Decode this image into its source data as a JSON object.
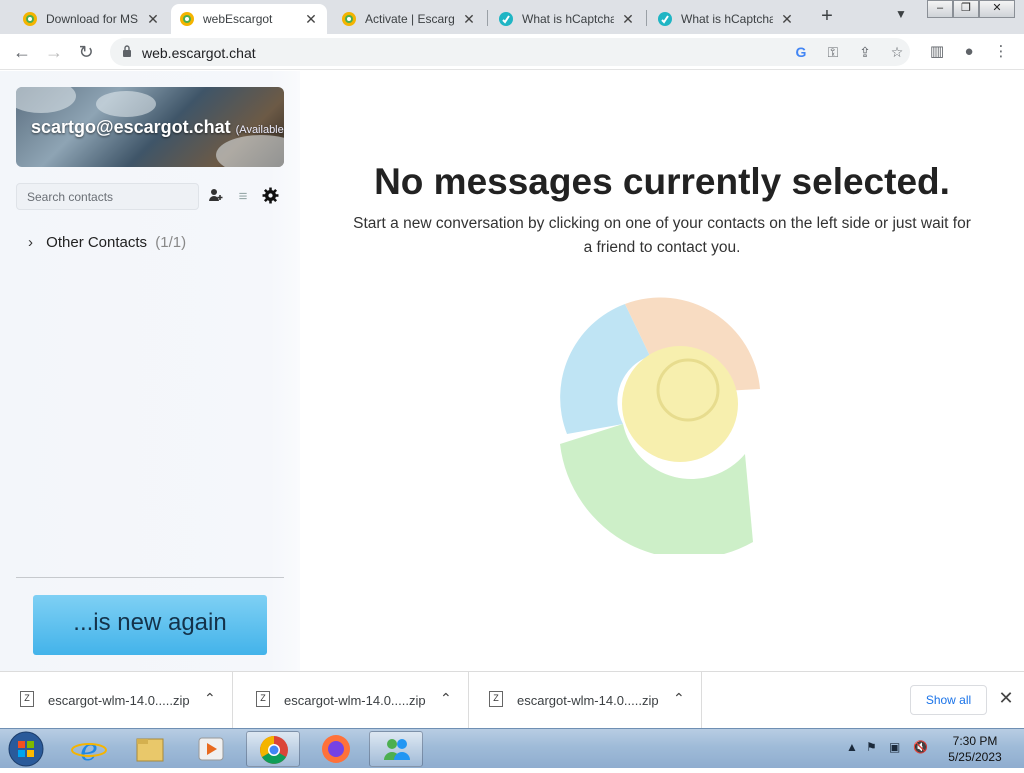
{
  "browser": {
    "tabs": [
      {
        "title": "Download for MSN",
        "favicon": "escargot-icon",
        "active": false
      },
      {
        "title": "webEscargot",
        "favicon": "escargot-icon",
        "active": true
      },
      {
        "title": "Activate | Escargot",
        "favicon": "escargot-icon",
        "active": false
      },
      {
        "title": "What is hCaptcha",
        "favicon": "hcaptcha-icon",
        "active": false
      },
      {
        "title": "What is hCaptcha",
        "favicon": "hcaptcha-icon",
        "active": false
      }
    ],
    "new_tab_label": "+",
    "url": "web.escargot.chat"
  },
  "sidebar": {
    "profile": {
      "email": "scartgo@escargot.chat",
      "status": "(Available)"
    },
    "search_placeholder": "Search contacts",
    "group": {
      "name": "Other Contacts",
      "count": "(1/1)"
    },
    "banner_text": "...is new again"
  },
  "main": {
    "title": "No messages currently selected.",
    "subtitle": "Start a new conversation by clicking on one of your contacts on the left side or just wait for a friend to contact you."
  },
  "downloads": {
    "items": [
      {
        "name": "escargot-wlm-14.0.....zip"
      },
      {
        "name": "escargot-wlm-14.0.....zip"
      },
      {
        "name": "escargot-wlm-14.0.....zip"
      }
    ],
    "show_all_label": "Show all"
  },
  "taskbar": {
    "time": "7:30 PM",
    "date": "5/25/2023"
  },
  "colors": {
    "accent": "#1a73e8",
    "banner": "#43b3ea",
    "logo_blue": "#bfe4f4",
    "logo_orange": "#f8dcc2",
    "logo_yellow": "#f7efae",
    "logo_green": "#cdefc8"
  }
}
